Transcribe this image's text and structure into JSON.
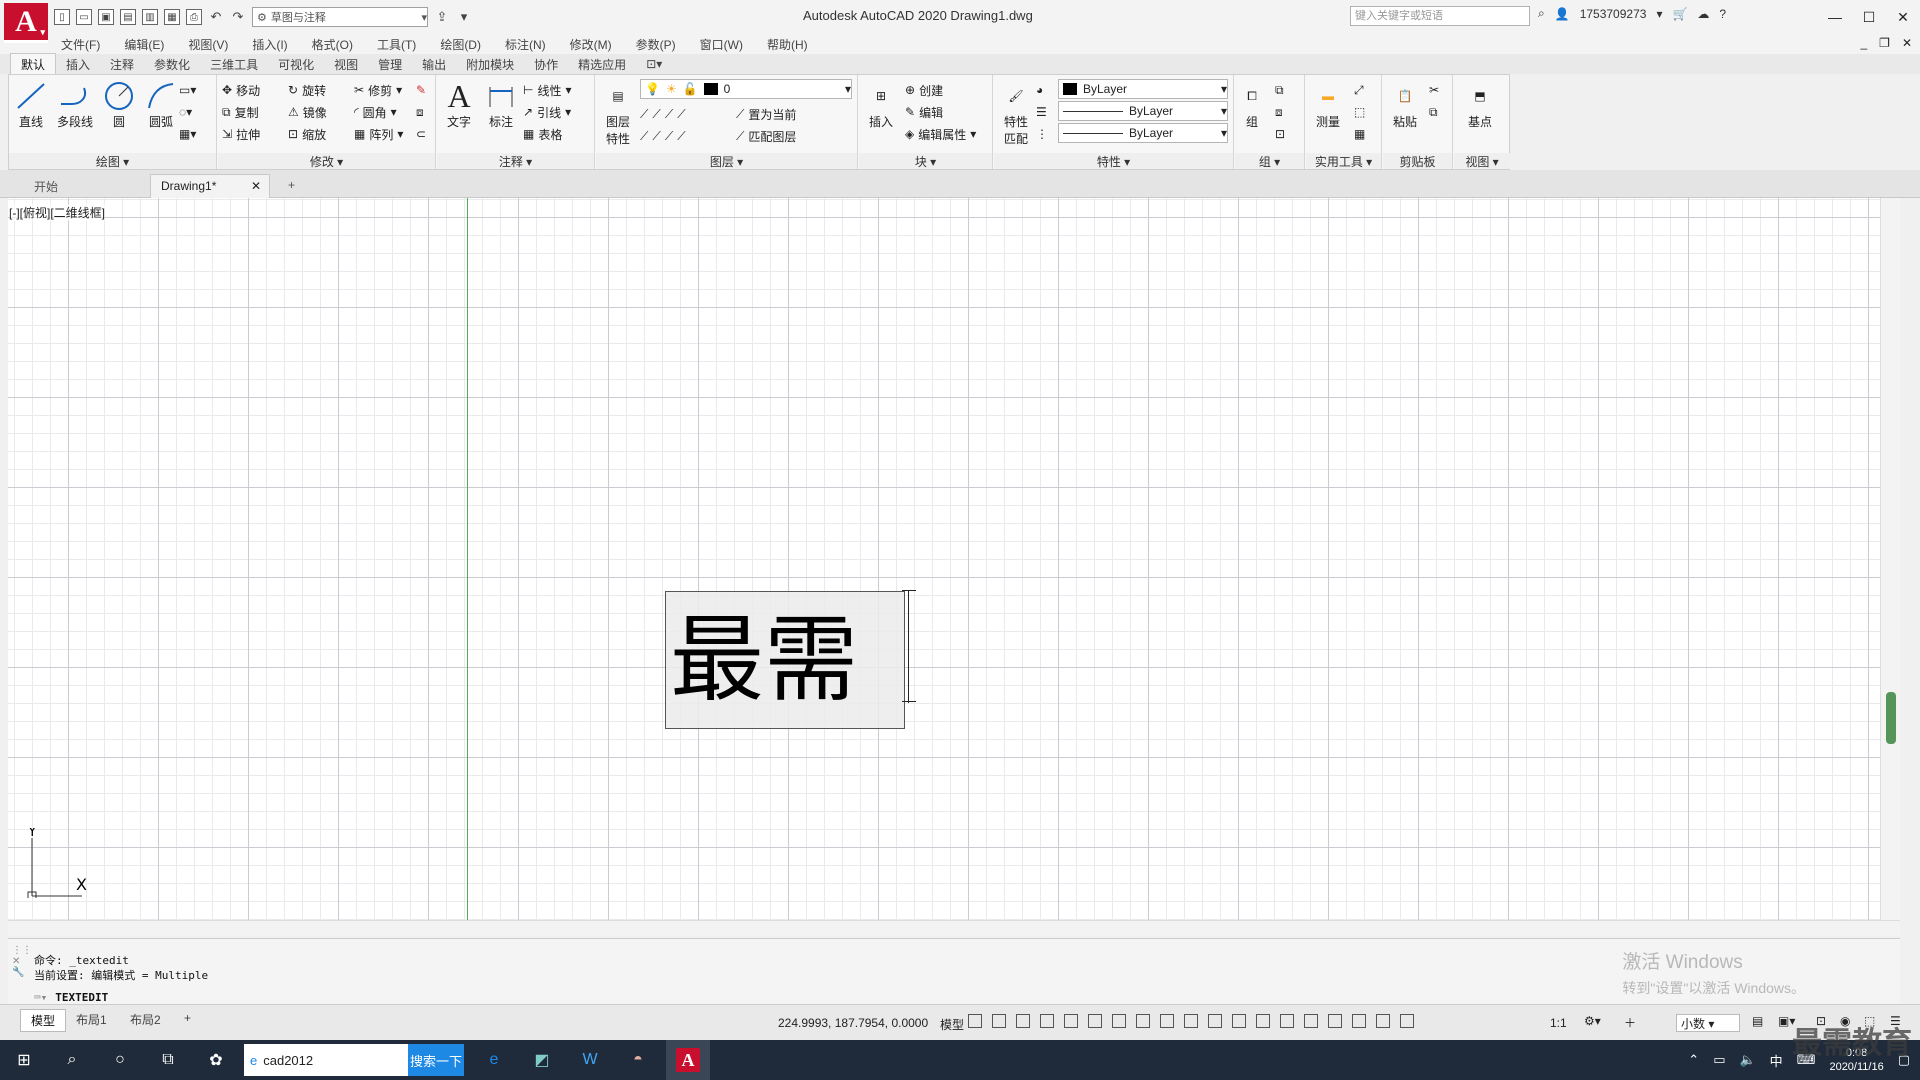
{
  "app": {
    "logo": "A",
    "title": "Autodesk AutoCAD 2020    Drawing1.dwg"
  },
  "qat": {
    "workspace": "草图与注释"
  },
  "search": {
    "placeholder": "键入关键字或短语"
  },
  "account": {
    "user": "1753709273"
  },
  "menu": [
    "文件(F)",
    "编辑(E)",
    "视图(V)",
    "插入(I)",
    "格式(O)",
    "工具(T)",
    "绘图(D)",
    "标注(N)",
    "修改(M)",
    "参数(P)",
    "窗口(W)",
    "帮助(H)"
  ],
  "ribbon_tabs": [
    "默认",
    "插入",
    "注释",
    "参数化",
    "三维工具",
    "可视化",
    "视图",
    "管理",
    "输出",
    "附加模块",
    "协作",
    "精选应用"
  ],
  "ribbon": {
    "draw": {
      "title": "绘图",
      "line": "直线",
      "polyline": "多段线",
      "circle": "圆",
      "arc": "圆弧"
    },
    "modify": {
      "title": "修改",
      "move": "移动",
      "rotate": "旋转",
      "trim": "修剪",
      "copy": "复制",
      "mirror": "镜像",
      "fillet": "圆角",
      "stretch": "拉伸",
      "scale": "缩放",
      "array": "阵列"
    },
    "annotation": {
      "title": "注释",
      "text": "文字",
      "dimension": "标注",
      "linear": "线性",
      "leader": "引线",
      "table": "表格"
    },
    "layers": {
      "title": "图层",
      "props_line1": "图层",
      "props_line2": "特性",
      "layer_value": "0",
      "make_current": "置为当前",
      "match_layer": "匹配图层"
    },
    "block": {
      "title": "块",
      "insert": "插入",
      "create": "创建",
      "edit": "编辑",
      "edit_attr": "编辑属性"
    },
    "properties": {
      "title": "特性",
      "match_line1": "特性",
      "match_line2": "匹配",
      "color": "ByLayer",
      "lineweight": "ByLayer",
      "linetype": "ByLayer"
    },
    "groups": {
      "title": "组",
      "group": "组"
    },
    "utilities": {
      "title": "实用工具",
      "measure": "测量"
    },
    "clipboard": {
      "title": "剪贴板",
      "paste": "粘贴"
    },
    "view": {
      "title": "视图",
      "base": "基点"
    }
  },
  "doc_tabs": {
    "start": "开始",
    "drawing": "Drawing1*",
    "close": "✕",
    "add": "+"
  },
  "viewport": {
    "label": "[-][俯视][二维线框]",
    "mtext": "最需"
  },
  "ucs": {
    "x": "X",
    "y": "Y"
  },
  "command": {
    "line1": "命令:  _textedit",
    "line2": "当前设置: 编辑模式 = Multiple",
    "current": "TEXTEDIT"
  },
  "watermark": {
    "line1": "激活 Windows",
    "line2": "转到\"设置\"以激活 Windows。"
  },
  "layout_tabs": [
    "模型",
    "布局1",
    "布局2"
  ],
  "status": {
    "coords": "224.9993, 187.7954, 0.0000",
    "model": "模型",
    "scale": "1:1",
    "units": "小数"
  },
  "taskbar": {
    "search_value": "cad2012",
    "search_button": "搜索一下",
    "time": "0:08",
    "date": "2020/11/16",
    "ime": "中"
  },
  "brand": "最需教育"
}
